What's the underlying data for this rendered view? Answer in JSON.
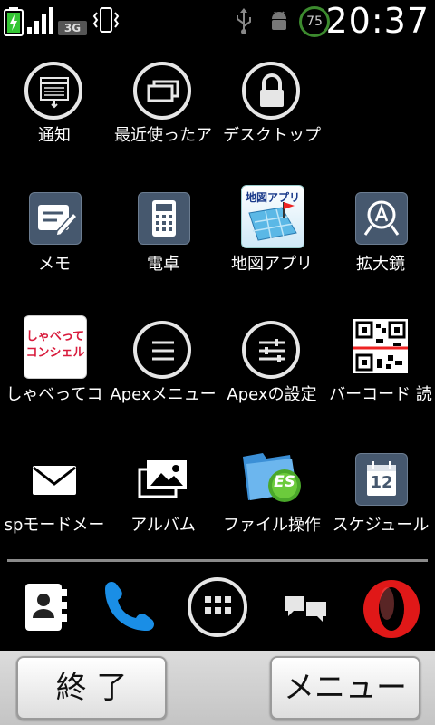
{
  "status_bar": {
    "network": "3G",
    "battery_badge": "75",
    "time": "20:37"
  },
  "apps": [
    {
      "label": "通知",
      "icon": "notification-icon"
    },
    {
      "label": "最近使ったア",
      "icon": "recent-apps-icon"
    },
    {
      "label": "デスクトップ",
      "icon": "lock-icon"
    },
    {
      "label": "メモ",
      "icon": "memo-icon"
    },
    {
      "label": "電卓",
      "icon": "calculator-icon"
    },
    {
      "label": "地図アプリ",
      "icon": "map-app-icon",
      "icon_text": "地図アプリ"
    },
    {
      "label": "拡大鏡",
      "icon": "magnifier-icon"
    },
    {
      "label": "しゃべってコ",
      "icon": "shabette-concier-icon",
      "icon_text_1": "しゃべって",
      "icon_text_2": "コンシェル"
    },
    {
      "label": "Apexメニュー",
      "icon": "menu-icon"
    },
    {
      "label": "Apexの設定",
      "icon": "settings-sliders-icon"
    },
    {
      "label": "バーコード 読",
      "icon": "qr-code-icon"
    },
    {
      "label": "spモードメー",
      "icon": "mail-icon"
    },
    {
      "label": "アルバム",
      "icon": "album-icon"
    },
    {
      "label": "ファイル操作",
      "icon": "file-manager-icon",
      "icon_text": "ES"
    },
    {
      "label": "スケジュール",
      "icon": "calendar-icon",
      "icon_text": "12"
    }
  ],
  "dock": {
    "items": [
      "contacts-icon",
      "phone-icon",
      "app-drawer-icon",
      "messaging-icon",
      "opera-icon"
    ]
  },
  "buttons": {
    "exit": "終 了",
    "menu": "メニュー"
  }
}
